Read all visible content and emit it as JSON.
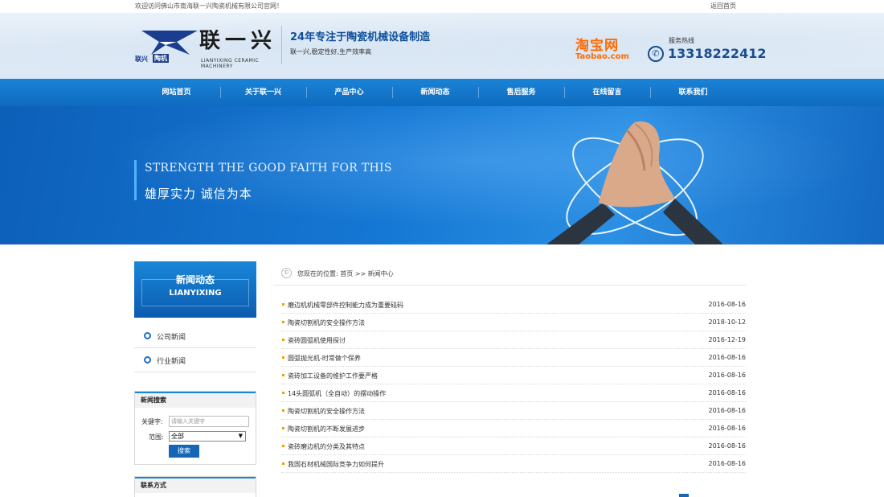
{
  "topbar": {
    "welcome": "欢迎访问佛山市南海联一兴陶瓷机械有限公司官网！",
    "home_link": "返回首页"
  },
  "header": {
    "logo_cn": "联一兴",
    "logo_en": "LIANYIXING CERAMIC MACHINERY",
    "logo_stamp_left": "联兴",
    "logo_stamp_right": "陶机",
    "slogan_title": "24年专注于陶瓷机械设备制造",
    "slogan_sub": "联一兴,稳定性好,生产效率高",
    "taobao_cn": "淘宝网",
    "taobao_en": "Taobao.com",
    "hotline_label": "服务热线",
    "hotline_number": "13318222412",
    "hotline_icon": "phone-icon"
  },
  "nav": {
    "items": [
      "网站首页",
      "关于联一兴",
      "产品中心",
      "新闻动态",
      "售后服务",
      "在线留言",
      "联系我们"
    ]
  },
  "banner": {
    "en_text": "STRENGTH THE GOOD FAITH FOR THIS",
    "cn_text": "雄厚实力  诚信为本"
  },
  "sidebar": {
    "head_cn": "新闻动态",
    "head_en": "LIANYIXING",
    "menu": [
      "公司新闻",
      "行业新闻"
    ],
    "search": {
      "title": "新闻搜索",
      "keyword_label": "关键字:",
      "keyword_placeholder": "请输入关键字",
      "scope_label": "范围:",
      "scope_value": "全部",
      "button": "搜索"
    },
    "contact_title": "联系方式"
  },
  "breadcrumb": {
    "text": "您现在的位置: 首页 >> 新闻中心"
  },
  "news": [
    {
      "title": "磨边机机械零部件控制能力成为重要砝码",
      "date": "2016-08-16"
    },
    {
      "title": "陶瓷切割机的安全操作方法",
      "date": "2018-10-12"
    },
    {
      "title": "瓷砖圆弧机使用探讨",
      "date": "2016-12-19"
    },
    {
      "title": "圆弧抛光机-时常做个保养",
      "date": "2016-08-16"
    },
    {
      "title": "瓷砖加工设备的维护工作要严格",
      "date": "2016-08-16"
    },
    {
      "title": "14头圆弧机（全自动）的摆动操作",
      "date": "2016-08-16"
    },
    {
      "title": "陶瓷切割机的安全操作方法",
      "date": "2016-08-16"
    },
    {
      "title": "陶瓷切割机的不断发展进步",
      "date": "2016-08-16"
    },
    {
      "title": "瓷砖磨边机的分类及其特点",
      "date": "2016-08-16"
    },
    {
      "title": "我国石材机械国际竞争力如何提升",
      "date": "2016-08-16"
    }
  ],
  "colors": {
    "brand_blue": "#0f6bbf",
    "accent_orange": "#ff6a00",
    "bullet": "#f0a000"
  }
}
